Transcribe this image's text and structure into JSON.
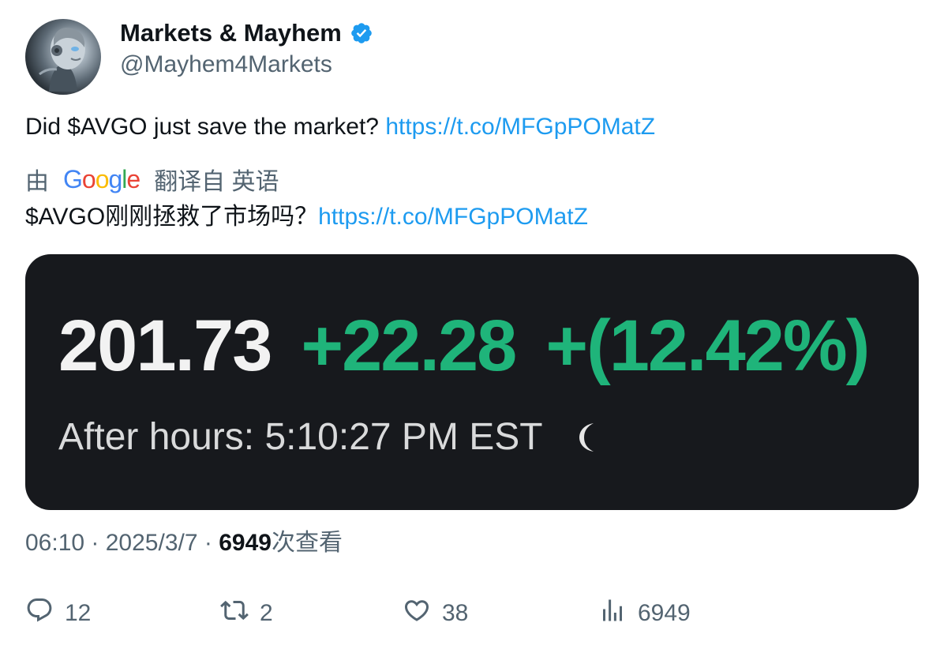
{
  "author": {
    "display_name": "Markets & Mayhem",
    "handle": "@Mayhem4Markets",
    "verified": true,
    "avatar_icon": "robot-avatar"
  },
  "tweet": {
    "text": "Did $AVGO just save the market? ",
    "link": "https://t.co/MFGpPOMatZ"
  },
  "translation": {
    "prefix": "由",
    "provider": "Google",
    "suffix": "翻译自 英语",
    "text": "$AVGO刚刚拯救了市场吗？",
    "link": "https://t.co/MFGpPOMatZ"
  },
  "media": {
    "price": "201.73",
    "change": "+22.28",
    "change_pct": "+(12.42%)",
    "after_hours": "After hours: 5:10:27 PM EST",
    "icon": "moon-icon",
    "background": "#17191d",
    "positive_color": "#1fb47a"
  },
  "meta": {
    "time": "06:10",
    "separator": " · ",
    "date": "2025/3/7",
    "separator2": " · ",
    "views": "6949",
    "views_label": "次查看"
  },
  "actions": {
    "reply_count": "12",
    "retweet_count": "2",
    "like_count": "38",
    "views_count": "6949"
  },
  "colors": {
    "accent": "#1d9bf0",
    "secondary_text": "#536471",
    "primary_text": "#0f1419"
  }
}
